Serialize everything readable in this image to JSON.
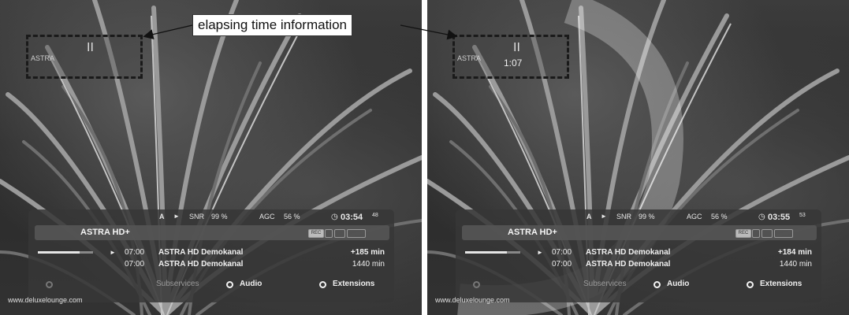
{
  "callout": {
    "text": "elapsing time information"
  },
  "screens": [
    {
      "recording": {
        "pause_symbol": "II",
        "channel_tiny": "ASTRA",
        "elapsed": ""
      },
      "status": {
        "audio_label": "A",
        "play_symbol": "►",
        "snr_label": "SNR",
        "snr_value": "99 %",
        "agc_label": "AGC",
        "agc_value": "56 %",
        "clock_icon": "clock-icon",
        "time": "03:54",
        "seconds": "48"
      },
      "channel": {
        "name": "ASTRA HD+",
        "rec_badge": "REC"
      },
      "progress_fraction": 0.75,
      "events": [
        {
          "play_symbol": "►",
          "time": "07:00",
          "title": "ASTRA HD Demokanal",
          "duration": "+185 min"
        },
        {
          "play_symbol": "",
          "time": "07:00",
          "title": "ASTRA HD Demokanal",
          "duration": "1440 min"
        }
      ],
      "buttons": {
        "subservices": "Subservices",
        "audio": "Audio",
        "extensions": "Extensions"
      },
      "watermark": "www.deluxelounge.com"
    },
    {
      "recording": {
        "pause_symbol": "II",
        "channel_tiny": "ASTRA",
        "elapsed": "1:07"
      },
      "status": {
        "audio_label": "A",
        "play_symbol": "►",
        "snr_label": "SNR",
        "snr_value": "99 %",
        "agc_label": "AGC",
        "agc_value": "56 %",
        "clock_icon": "clock-icon",
        "time": "03:55",
        "seconds": "53"
      },
      "channel": {
        "name": "ASTRA HD+",
        "rec_badge": "REC"
      },
      "progress_fraction": 0.75,
      "events": [
        {
          "play_symbol": "►",
          "time": "07:00",
          "title": "ASTRA HD Demokanal",
          "duration": "+184 min"
        },
        {
          "play_symbol": "",
          "time": "07:00",
          "title": "ASTRA HD Demokanal",
          "duration": "1440 min"
        }
      ],
      "buttons": {
        "subservices": "Subservices",
        "audio": "Audio",
        "extensions": "Extensions"
      },
      "watermark": "www.deluxelounge.com"
    }
  ]
}
